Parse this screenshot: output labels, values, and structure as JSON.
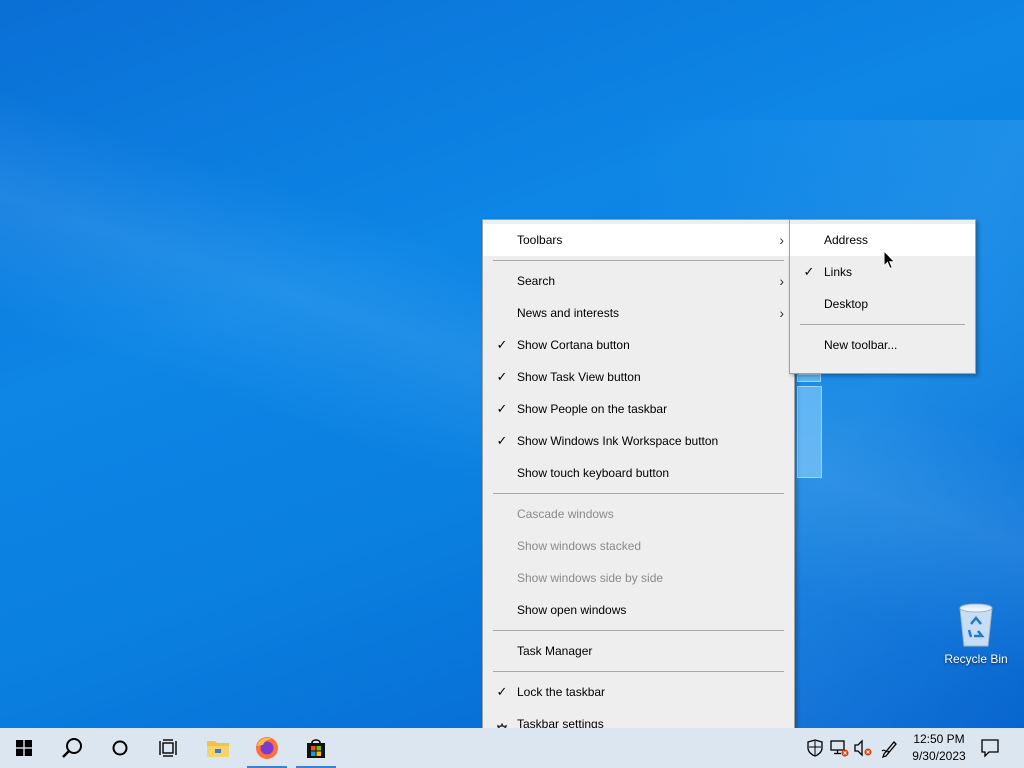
{
  "desktop": {
    "recycle_bin_label": "Recycle Bin"
  },
  "context_menu": {
    "items": [
      {
        "label": "Toolbars",
        "checked": false,
        "submenu": true,
        "disabled": false,
        "highlighted": true
      },
      {
        "label": "Search",
        "checked": false,
        "submenu": true,
        "disabled": false
      },
      {
        "label": "News and interests",
        "checked": false,
        "submenu": true,
        "disabled": false
      },
      {
        "label": "Show Cortana button",
        "checked": true,
        "disabled": false
      },
      {
        "label": "Show Task View button",
        "checked": true,
        "disabled": false
      },
      {
        "label": "Show People on the taskbar",
        "checked": true,
        "disabled": false
      },
      {
        "label": "Show Windows Ink Workspace button",
        "checked": true,
        "disabled": false
      },
      {
        "label": "Show touch keyboard button",
        "checked": false,
        "disabled": false
      },
      {
        "label": "Cascade windows",
        "checked": false,
        "disabled": true
      },
      {
        "label": "Show windows stacked",
        "checked": false,
        "disabled": true
      },
      {
        "label": "Show windows side by side",
        "checked": false,
        "disabled": true
      },
      {
        "label": "Show open windows",
        "checked": false,
        "disabled": false
      },
      {
        "label": "Task Manager",
        "checked": false,
        "disabled": false
      },
      {
        "label": "Lock the taskbar",
        "checked": true,
        "disabled": false
      },
      {
        "label": "Taskbar settings",
        "icon": "gear-icon",
        "disabled": false
      }
    ],
    "check_glyph": "✓",
    "arrow_glyph": "›"
  },
  "toolbars_submenu": {
    "items": [
      {
        "label": "Address",
        "checked": false,
        "highlighted": true
      },
      {
        "label": "Links",
        "checked": true
      },
      {
        "label": "Desktop",
        "checked": false
      },
      {
        "label": "New toolbar...",
        "checked": false
      }
    ]
  },
  "taskbar": {
    "pinned": [
      {
        "name": "start-button",
        "icon": "windows-logo-icon"
      },
      {
        "name": "search-button",
        "icon": "search-icon"
      },
      {
        "name": "cortana-button",
        "icon": "cortana-circle-icon"
      },
      {
        "name": "task-view-button",
        "icon": "task-view-icon"
      },
      {
        "name": "file-explorer-button",
        "icon": "folder-icon"
      },
      {
        "name": "firefox-button",
        "icon": "firefox-icon",
        "active": true
      },
      {
        "name": "store-button",
        "icon": "store-bag-icon",
        "active": true
      }
    ],
    "tray": [
      {
        "name": "security-tray-icon",
        "icon": "shield-icon"
      },
      {
        "name": "network-tray-icon",
        "icon": "network-disconnected-icon"
      },
      {
        "name": "volume-tray-icon",
        "icon": "volume-muted-icon"
      },
      {
        "name": "ink-workspace-icon",
        "icon": "pen-icon"
      }
    ],
    "clock": {
      "time": "12:50 PM",
      "date": "9/30/2023"
    },
    "colors": {
      "taskbar_bg": "#dce6f1",
      "active_indicator": "#3f7fd0"
    }
  }
}
